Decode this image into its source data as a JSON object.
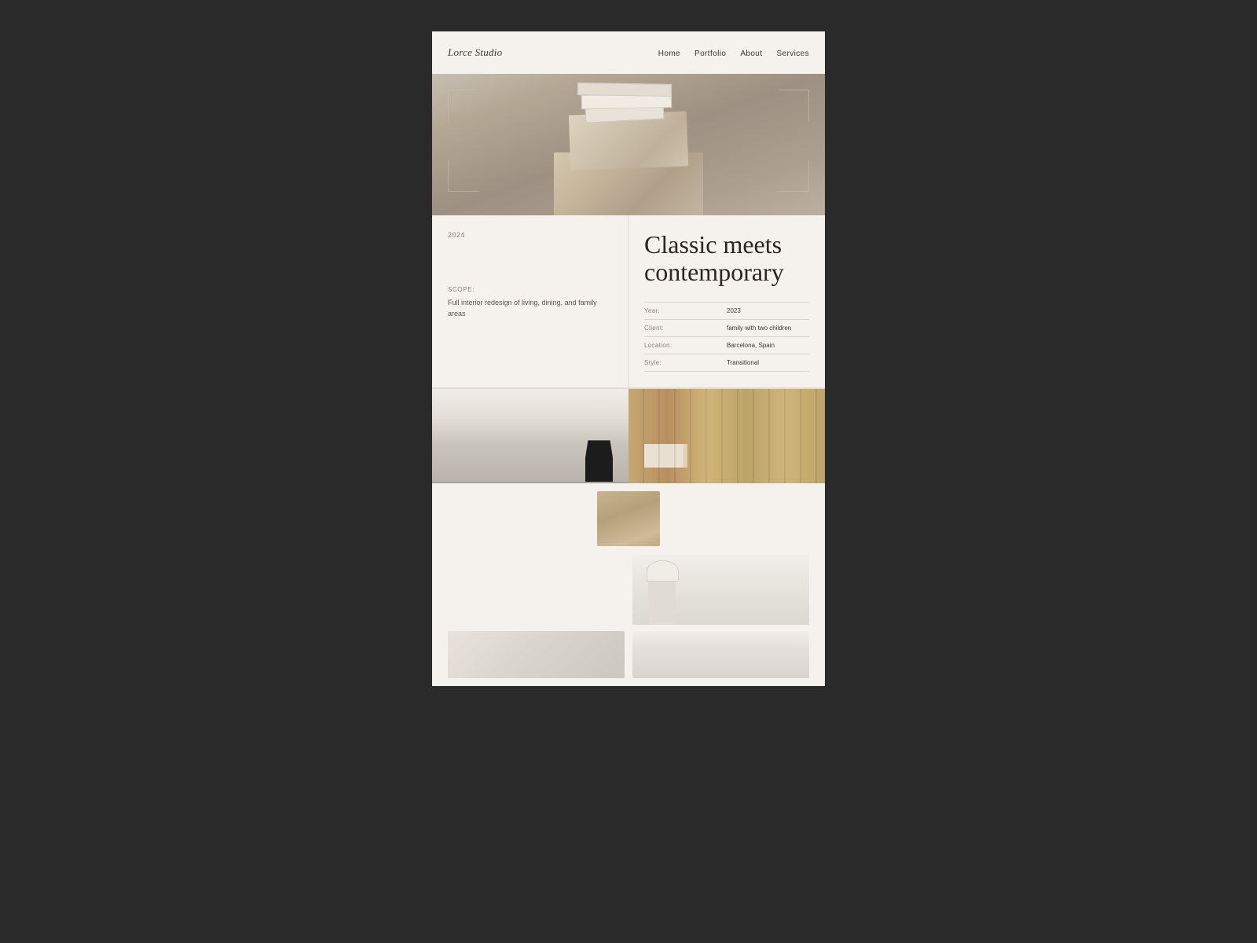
{
  "nav": {
    "logo": "Lorce Studio",
    "links": [
      {
        "label": "Home",
        "id": "home"
      },
      {
        "label": "Portfolio",
        "id": "portfolio"
      },
      {
        "label": "About",
        "id": "about"
      },
      {
        "label": "Services",
        "id": "services"
      }
    ]
  },
  "project": {
    "year": "2024",
    "title_line1": "Classic meets",
    "title_line2": "contemporary",
    "scope_label": "SCOPE:",
    "scope_text": "Full interior redesign of living, dining, and family areas",
    "details": [
      {
        "label": "Year:",
        "value": "2023"
      },
      {
        "label": "Client:",
        "value": "family with two children"
      },
      {
        "label": "Location:",
        "value": "Barcelona, Spain"
      },
      {
        "label": "Style:",
        "value": "Transitional"
      }
    ]
  },
  "gallery": {
    "images": [
      {
        "id": "chair-room",
        "alt": "Interior with chair"
      },
      {
        "id": "wood-shelf",
        "alt": "Wood panel shelf with books"
      },
      {
        "id": "hallway",
        "alt": "Hallway interior"
      },
      {
        "id": "bedroom-lamp",
        "alt": "Bedroom with lamp"
      },
      {
        "id": "decor-items",
        "alt": "Decorative items"
      },
      {
        "id": "bedroom-bed",
        "alt": "Bedroom view"
      }
    ]
  },
  "colors": {
    "background": "#2a2a2a",
    "site_bg": "#f5f2ed",
    "text_dark": "#2a2520",
    "text_mid": "#5a5248",
    "text_light": "#8a8278",
    "border": "#e0dbd4"
  }
}
